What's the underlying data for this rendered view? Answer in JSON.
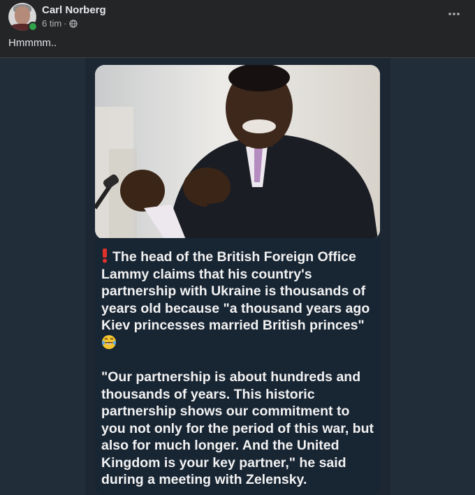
{
  "post": {
    "author": "Carl Norberg",
    "time": "6 tim",
    "separator": "·",
    "text": "Hmmmm.."
  },
  "icons": {
    "more": "more-options-icon",
    "privacy": "globe-icon",
    "alert": "red-exclamation-icon",
    "emoji": "laughing-tears-emoji"
  },
  "colors": {
    "background": "#242526",
    "media_background": "#212e3a",
    "telegram_bubble": "#182533",
    "online": "#31a24c",
    "alert_red": "#e0312b"
  },
  "image_text": {
    "headline": "The head of the British Foreign Office Lammy claims that his country's partnership with Ukraine is thousands of years old because \"a thousand years ago Kiev princesses married British princes\"",
    "quote": "\"Our partnership is about hundreds and thousands of years. This historic partnership shows our commitment to you not only for the period of this war, but also for much longer. And the United Kingdom is your key partner,\" he said during a meeting with Zelensky."
  }
}
